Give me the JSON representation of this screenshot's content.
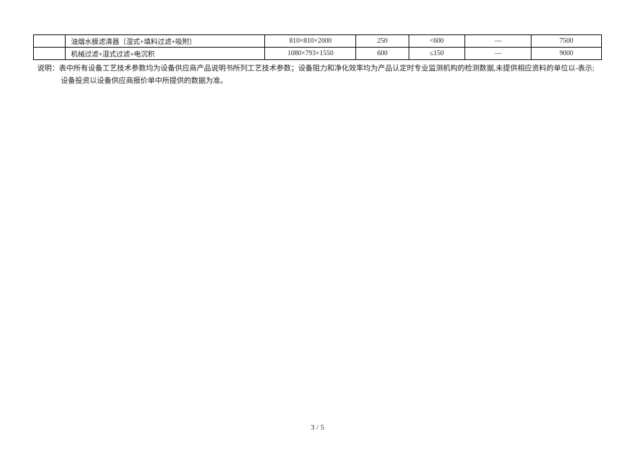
{
  "table": {
    "rows": [
      {
        "c0": "",
        "c1": "油烟水膜滤清器〔湿式+填料过滤+吸附〕",
        "c2": "810×810×2000",
        "c3": "250",
        "c4": "<600",
        "c5": "—",
        "c6": "7500"
      },
      {
        "c0": "",
        "c1": "机械过滤+湿式过滤+电沉积",
        "c2": "1080×793×1550",
        "c3": "600",
        "c4": "≤150",
        "c5": "—",
        "c6": "9000"
      }
    ]
  },
  "note": {
    "label": "说明：",
    "line1": "表中所有设备工艺技术参数均为设备供应商产品说明书所列工艺技术参数；设备阻力和净化效率均为产品认定时专业监测机构的检测数据,未提供相应资料的单位以-表示;",
    "line2": "设备投资以设备供应商报价单中所提供的数据为准。"
  },
  "page_number": "3 / 5"
}
